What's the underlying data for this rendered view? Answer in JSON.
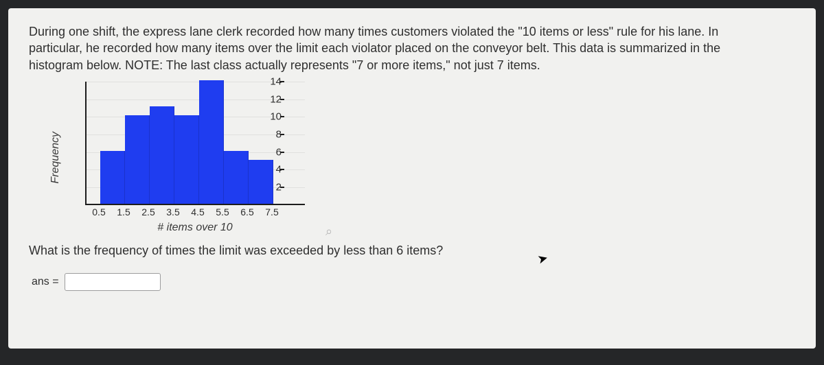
{
  "problem_text": "During one shift, the express lane clerk recorded how many times customers violated the \"10 items or less\" rule for his lane. In particular, he recorded how many items over the limit each violator placed on the conveyor belt. This data is summarized in the histogram below. NOTE: The last class actually represents \"7 or more items,\" not just 7 items.",
  "question_text": "What is the frequency of times the limit was exceeded by less than 6 items?",
  "answer_label": "ans =",
  "answer_value": "",
  "chart_data": {
    "type": "bar",
    "title": "",
    "xlabel": "# items over 10",
    "ylabel": "Frequency",
    "ylim": [
      0,
      14
    ],
    "y_ticks": [
      2,
      4,
      6,
      8,
      10,
      12,
      14
    ],
    "x_ticks": [
      "0.5",
      "1.5",
      "2.5",
      "3.5",
      "4.5",
      "5.5",
      "6.5",
      "7.5"
    ],
    "categories": [
      1,
      2,
      3,
      4,
      5,
      6,
      7
    ],
    "values": [
      6,
      10,
      11,
      10,
      14,
      6,
      5
    ]
  }
}
